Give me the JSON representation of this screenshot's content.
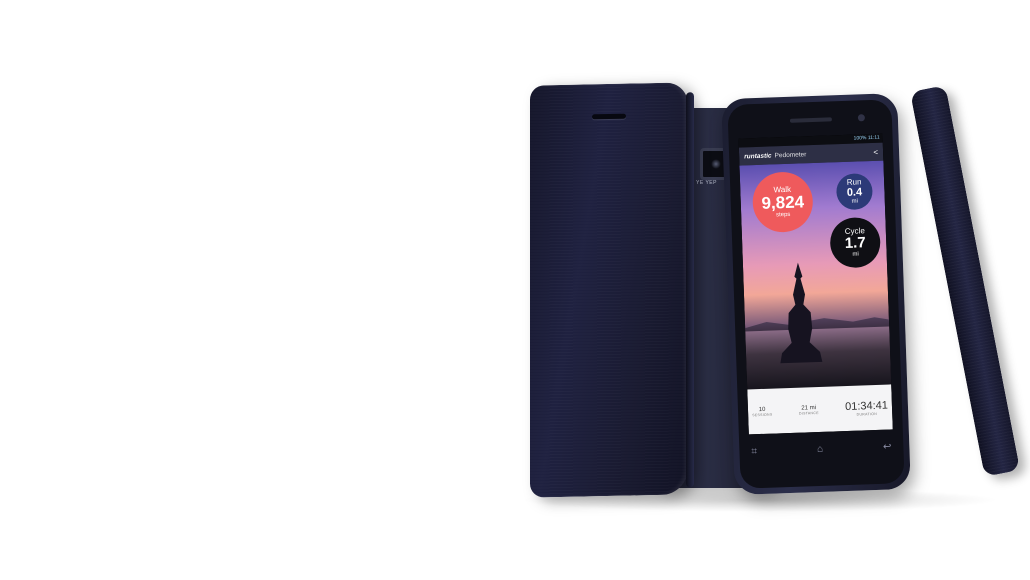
{
  "scene": {
    "background": "#ffffff",
    "cover_color": "#1b1c33",
    "accent_walk": "#ef5a5c",
    "accent_run": "#2c3a78",
    "accent_cycle": "#0f0f14"
  },
  "back_phone": {
    "brand_text": "YE YEP"
  },
  "screen": {
    "status_time": "100% 11:11",
    "app_logo": "runtastic",
    "app_name": "Pedometer",
    "share_icon": "share-icon",
    "walk": {
      "label": "Walk",
      "value": "9,824",
      "unit": "steps"
    },
    "run": {
      "label": "Run",
      "value": "0.4",
      "unit": "mi"
    },
    "cycle": {
      "label": "Cycle",
      "value": "1.7",
      "unit": "mi"
    },
    "stats": [
      {
        "value": "10",
        "label": "SESSIONS"
      },
      {
        "value": "21 mi",
        "label": "DISTANCE"
      },
      {
        "value": "01:34:41",
        "label": "DURATION"
      }
    ],
    "nav_icons": [
      "apps-icon",
      "home-icon",
      "back-icon"
    ]
  }
}
